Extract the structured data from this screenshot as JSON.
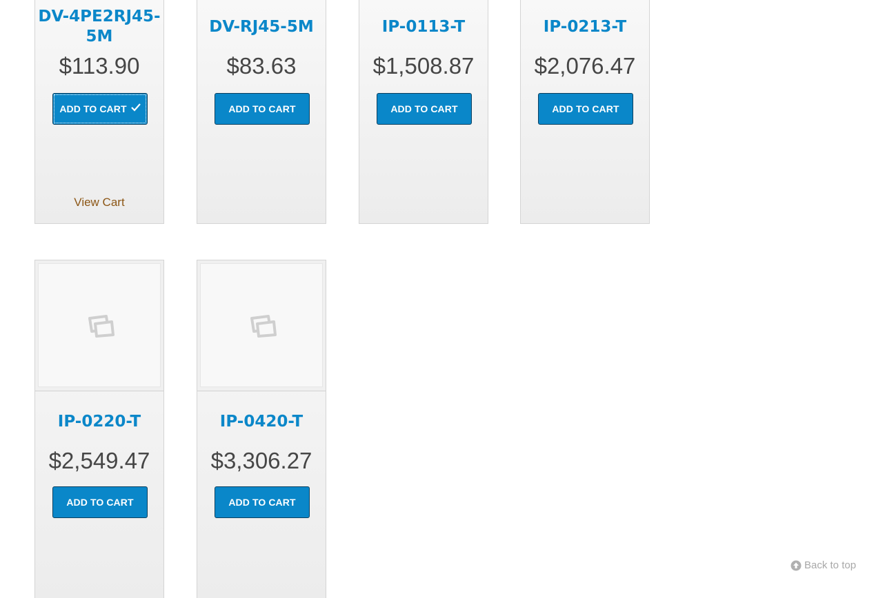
{
  "products": [
    {
      "name": "DV-4PE2RJ45-5M",
      "name_line1": "DV-4PE2RJ45-",
      "name_line2": "5M",
      "price": "$113.90",
      "button": "ADD TO CART",
      "view_cart": "View Cart",
      "added": true
    },
    {
      "name": "DV-RJ45-5M",
      "price": "$83.63",
      "button": "ADD TO CART"
    },
    {
      "name": "IP-0113-T",
      "price": "$1,508.87",
      "button": "ADD TO CART"
    },
    {
      "name": "IP-0213-T",
      "price": "$2,076.47",
      "button": "ADD TO CART"
    },
    {
      "name": "IP-0220-T",
      "price": "$2,549.47",
      "button": "ADD TO CART",
      "image": "placeholder-image-icon"
    },
    {
      "name": "IP-0420-T",
      "price": "$3,306.27",
      "button": "ADD TO CART",
      "image": "placeholder-image-icon"
    }
  ],
  "back_to_top": "Back to top",
  "colors": {
    "accent": "#0a87c9",
    "title": "#0b87c9",
    "price": "#464646",
    "view_cart": "#8c5615"
  }
}
